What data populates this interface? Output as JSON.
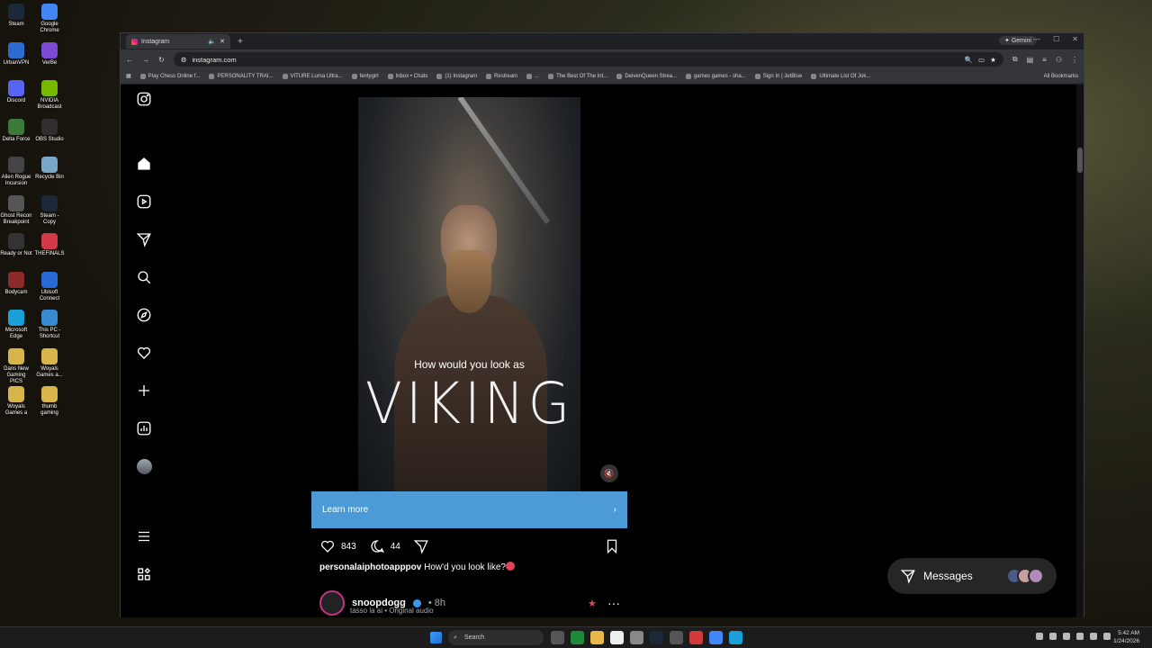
{
  "desktop": {
    "icons": [
      {
        "label": "Steam",
        "color": "#1b2838"
      },
      {
        "label": "Google Chrome",
        "color": "#4285f4"
      },
      {
        "label": "UrbanVPN",
        "color": "#2c6bd1"
      },
      {
        "label": "VerBe",
        "color": "#7b4bd6"
      },
      {
        "label": "Discord",
        "color": "#5865f2"
      },
      {
        "label": "NVIDIA Broadcast",
        "color": "#76b900"
      },
      {
        "label": "Delta Force",
        "color": "#3a7b3a"
      },
      {
        "label": "OBS Studio",
        "color": "#302e31"
      },
      {
        "label": "Alien Rogue Incursion",
        "color": "#444"
      },
      {
        "label": "Recycle Bin",
        "color": "#7aa7c7"
      },
      {
        "label": "Ghost Recon Breakpoint",
        "color": "#555"
      },
      {
        "label": "Steam - Copy",
        "color": "#1b2838"
      },
      {
        "label": "Ready or Not",
        "color": "#333"
      },
      {
        "label": "THEFINALS",
        "color": "#d23a4a"
      },
      {
        "label": "Bodycam",
        "color": "#8a2a2a"
      },
      {
        "label": "Ubisoft Connect",
        "color": "#2a6ad6"
      },
      {
        "label": "Microsoft Edge",
        "color": "#1a9fd9"
      },
      {
        "label": "This PC - Shortcut",
        "color": "#3a8ad0"
      },
      {
        "label": "Dans New Gaming PICS",
        "color": "#d8b54a"
      },
      {
        "label": "Woyals Games a...",
        "color": "#d8b54a"
      },
      {
        "label": "Woyals Games a",
        "color": "#d8b54a"
      },
      {
        "label": "thumb gaming",
        "color": "#d8b54a"
      }
    ]
  },
  "browser": {
    "tab_title": "Instagram",
    "gemini_label": "Gemini",
    "url": "instagram.com",
    "bookmarks": [
      "Play Chess Online f...",
      "PERSONALITY TRAI...",
      "VITURE Luma Ultra...",
      "fentygirl",
      "Inbox • Chats",
      "(1) Instagram",
      "Restream",
      "...",
      "The Best Of The Int...",
      "DeivenQueen Strea...",
      "games games - sha...",
      "Sign In | JetBlue",
      "Ultimate List Of Jok..."
    ],
    "all_bookmarks": "All Bookmarks"
  },
  "post": {
    "caption_top": "How would you look as",
    "caption_big": "VIKING",
    "learn_more": "Learn more",
    "likes": "843",
    "comments": "44",
    "username": "personalaiphotoapppov",
    "caption": "How'd you look like?"
  },
  "next_post": {
    "username": "snoopdogg",
    "time": "• 8h",
    "subtitle": "tasso la ai • Original audio"
  },
  "messages": {
    "label": "Messages",
    "avatar_colors": [
      "#4a5a8a",
      "#c8a0a0",
      "#b08ab8"
    ]
  },
  "taskbar": {
    "search_placeholder": "Search",
    "time": "5:42 AM",
    "date": "1/24/2026"
  }
}
